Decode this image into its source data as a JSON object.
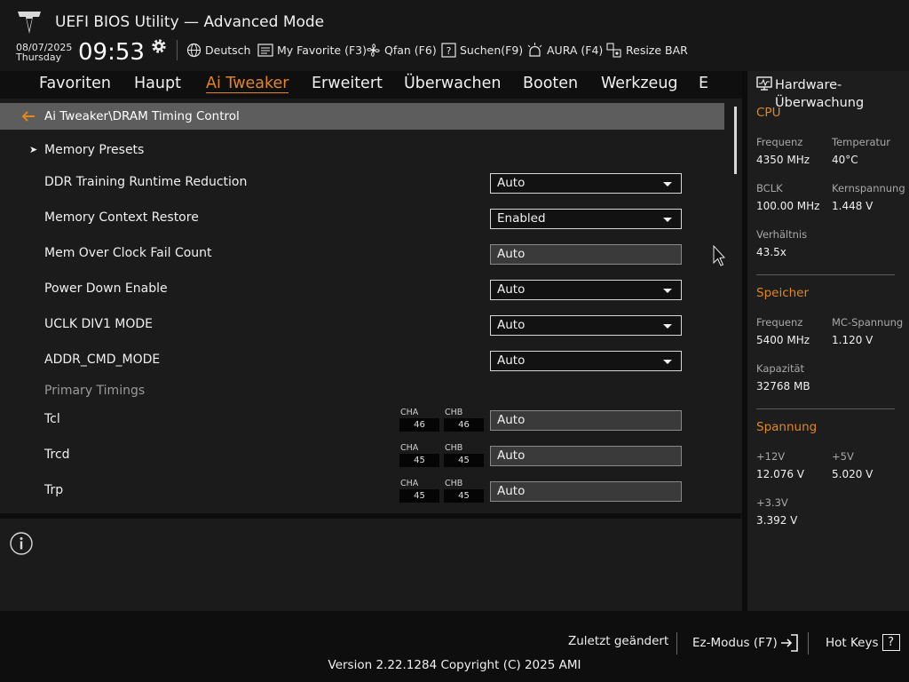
{
  "header": {
    "title": "UEFI BIOS Utility — Advanced Mode",
    "date": "08/07/2025",
    "weekday": "Thursday",
    "time": "09:53",
    "tools": [
      {
        "label": "Deutsch",
        "icon": "globe-icon"
      },
      {
        "label": "My Favorite (F3)",
        "icon": "favorite-icon"
      },
      {
        "label": "Qfan (F6)",
        "icon": "fan-icon"
      },
      {
        "label": "Suchen(F9)",
        "icon": "help-search-icon"
      },
      {
        "label": "AURA (F4)",
        "icon": "aura-light-icon"
      },
      {
        "label": "Resize BAR",
        "icon": "resize-bar-icon"
      }
    ]
  },
  "tabs": [
    {
      "label": "Favoriten"
    },
    {
      "label": "Haupt"
    },
    {
      "label": "Ai Tweaker",
      "active": true
    },
    {
      "label": "Erweitert"
    },
    {
      "label": "Überwachen"
    },
    {
      "label": "Booten"
    },
    {
      "label": "Werkzeug"
    },
    {
      "label": "E"
    }
  ],
  "breadcrumb": "Ai Tweaker\\DRAM Timing Control",
  "settings": [
    {
      "label": "Memory Presets"
    },
    {
      "label": "DDR Training Runtime Reduction",
      "value": "Auto"
    },
    {
      "label": "Memory Context Restore",
      "value": "Enabled"
    },
    {
      "label": "Mem Over Clock Fail Count",
      "value": "Auto"
    },
    {
      "label": "Power Down Enable",
      "value": "Auto"
    },
    {
      "label": "UCLK DIV1 MODE",
      "value": "Auto"
    },
    {
      "label": "ADDR_CMD_MODE",
      "value": "Auto"
    },
    {
      "label": "Primary Timings"
    },
    {
      "label": "Tcl",
      "cha": "46",
      "chb": "46",
      "value": "Auto"
    },
    {
      "label": "Trcd",
      "cha": "45",
      "chb": "45",
      "value": "Auto"
    },
    {
      "label": "Trp",
      "cha": "45",
      "chb": "45",
      "value": "Auto"
    }
  ],
  "channels": {
    "a": "CHA",
    "b": "CHB"
  },
  "hardware_monitor": {
    "title": "Hardware-Überwachung",
    "cpu": {
      "title": "CPU",
      "freq_label": "Frequenz",
      "freq": "4350 MHz",
      "temp_label": "Temperatur",
      "temp": "40°C",
      "bclk_label": "BCLK",
      "bclk": "100.00 MHz",
      "vcore_label": "Kernspannung",
      "vcore": "1.448 V",
      "ratio_label": "Verhältnis",
      "ratio": "43.5x"
    },
    "memory": {
      "title": "Speicher",
      "freq_label": "Frequenz",
      "freq": "5400 MHz",
      "mc_label": "MC-Spannung",
      "mc": "1.120 V",
      "cap_label": "Kapazität",
      "cap": "32768 MB"
    },
    "voltage": {
      "title": "Spannung",
      "v12_label": "+12V",
      "v12": "12.076 V",
      "v5_label": "+5V",
      "v5": "5.020 V",
      "v33_label": "+3.3V",
      "v33": "3.392 V"
    }
  },
  "footer": {
    "last_modified": "Zuletzt geändert",
    "ez_mode": "Ez-Modus (F7)",
    "hot_keys": "Hot Keys",
    "hot_keys_icon_glyph": "?",
    "version": "Version 2.22.1284 Copyright (C) 2025 AMI"
  },
  "colors": {
    "accent": "#e2861f",
    "background": "#121212",
    "breadcrumb_bar": "#5d5d5d"
  }
}
